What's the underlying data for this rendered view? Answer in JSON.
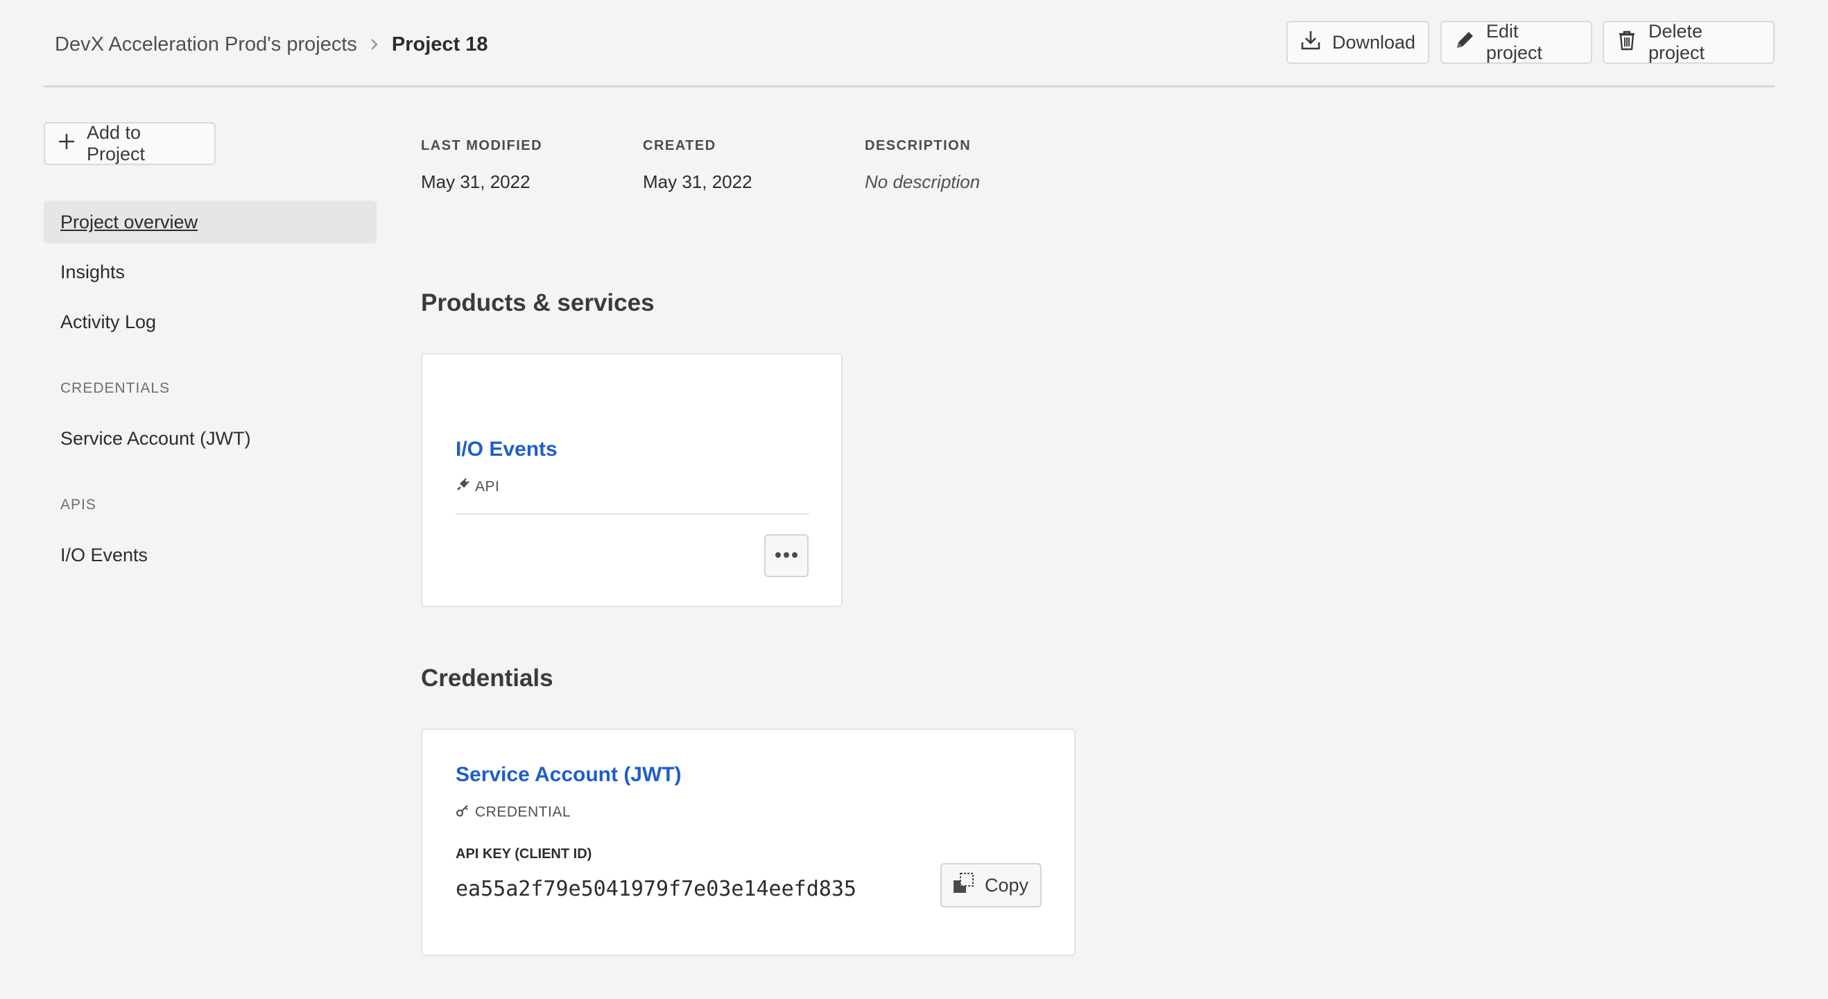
{
  "header": {
    "breadcrumb_parent": "DevX Acceleration Prod's projects",
    "breadcrumb_current": "Project 18",
    "download_label": "Download",
    "edit_label": "Edit project",
    "delete_label": "Delete project"
  },
  "sidebar": {
    "add_label": "Add to Project",
    "nav": [
      {
        "label": "Project overview",
        "active": true
      },
      {
        "label": "Insights"
      },
      {
        "label": "Activity Log"
      }
    ],
    "credentials_heading": "CREDENTIALS",
    "credentials_items": [
      "Service Account (JWT)"
    ],
    "apis_heading": "APIS",
    "apis_items": [
      "I/O Events"
    ]
  },
  "meta": {
    "last_modified_label": "LAST MODIFIED",
    "last_modified_value": "May 31, 2022",
    "created_label": "CREATED",
    "created_value": "May 31, 2022",
    "description_label": "DESCRIPTION",
    "description_value": "No description"
  },
  "products": {
    "title": "Products & services",
    "card": {
      "name": "I/O Events",
      "tag": "API"
    }
  },
  "credentials": {
    "title": "Credentials",
    "card": {
      "name": "Service Account (JWT)",
      "tag": "CREDENTIAL",
      "api_key_label": "API KEY (CLIENT ID)",
      "api_key_value": "ea55a2f79e5041979f7e03e14eefd835",
      "copy_label": "Copy"
    }
  },
  "colors": {
    "link": "#1e5fc8",
    "background": "#f4f4f4"
  }
}
